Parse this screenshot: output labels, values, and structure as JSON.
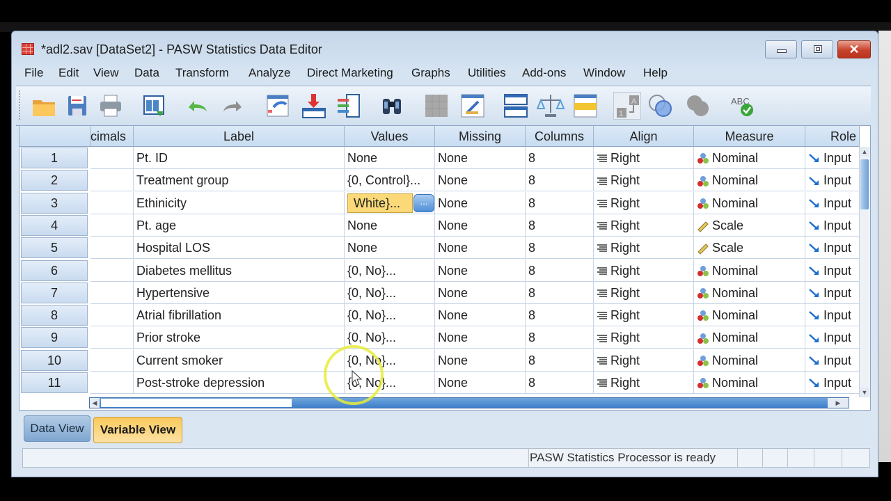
{
  "window": {
    "title": "*adl2.sav [DataSet2] - PASW Statistics Data Editor",
    "controls": {
      "minimize": "minimize",
      "maximize": "maximize",
      "close": "✕"
    }
  },
  "menu": [
    "File",
    "Edit",
    "View",
    "Data",
    "Transform",
    "Analyze",
    "Direct Marketing",
    "Graphs",
    "Utilities",
    "Add-ons",
    "Window",
    "Help"
  ],
  "toolbar": [
    "open-folder-icon",
    "save-icon",
    "print-icon",
    "recall-dialog-icon",
    "undo-icon",
    "redo-icon",
    "goto-case-icon",
    "goto-variable-icon",
    "variables-icon",
    "find-icon",
    "insert-cases-icon",
    "insert-variable-icon",
    "split-file-icon",
    "weight-cases-icon",
    "select-cases-icon",
    "value-labels-icon",
    "use-variable-sets-icon",
    "show-all-variables-icon",
    "spell-check-icon"
  ],
  "grid": {
    "columns": [
      "cimals",
      "Label",
      "Values",
      "Missing",
      "Columns",
      "Align",
      "Measure",
      "Role"
    ],
    "rows": [
      {
        "n": "1",
        "label": "Pt. ID",
        "values": "None",
        "missing": "None",
        "columns": "8",
        "align": "Right",
        "measure": "Nominal",
        "role": "Input"
      },
      {
        "n": "2",
        "label": "Treatment group",
        "values": "{0, Control}...",
        "missing": "None",
        "columns": "8",
        "align": "Right",
        "measure": "Nominal",
        "role": "Input"
      },
      {
        "n": "3",
        "label": "Ethinicity",
        "values": "White}...",
        "missing": "None",
        "columns": "8",
        "align": "Right",
        "measure": "Nominal",
        "role": "Input"
      },
      {
        "n": "4",
        "label": "Pt. age",
        "values": "None",
        "missing": "None",
        "columns": "8",
        "align": "Right",
        "measure": "Scale",
        "role": "Input"
      },
      {
        "n": "5",
        "label": "Hospital LOS",
        "values": "None",
        "missing": "None",
        "columns": "8",
        "align": "Right",
        "measure": "Scale",
        "role": "Input"
      },
      {
        "n": "6",
        "label": "Diabetes mellitus",
        "values": "{0, No}...",
        "missing": "None",
        "columns": "8",
        "align": "Right",
        "measure": "Nominal",
        "role": "Input"
      },
      {
        "n": "7",
        "label": "Hypertensive",
        "values": "{0, No}...",
        "missing": "None",
        "columns": "8",
        "align": "Right",
        "measure": "Nominal",
        "role": "Input"
      },
      {
        "n": "8",
        "label": "Atrial fibrillation",
        "values": "{0, No}...",
        "missing": "None",
        "columns": "8",
        "align": "Right",
        "measure": "Nominal",
        "role": "Input"
      },
      {
        "n": "9",
        "label": "Prior stroke",
        "values": "{0, No}...",
        "missing": "None",
        "columns": "8",
        "align": "Right",
        "measure": "Nominal",
        "role": "Input"
      },
      {
        "n": "10",
        "label": "Current smoker",
        "values": "{0, No}...",
        "missing": "None",
        "columns": "8",
        "align": "Right",
        "measure": "Nominal",
        "role": "Input"
      },
      {
        "n": "11",
        "label": "Post-stroke depression",
        "values": "{0, No}...",
        "missing": "None",
        "columns": "8",
        "align": "Right",
        "measure": "Nominal",
        "role": "Input"
      }
    ],
    "editing_row": 2,
    "ellipsis_label": "..."
  },
  "tabs": {
    "data_view": "Data View",
    "variable_view": "Variable View",
    "active": "Variable View"
  },
  "status": {
    "text": "PASW Statistics Processor is ready"
  },
  "colors": {
    "active_tab": "#f9c95c",
    "editing_cell": "#fbd978",
    "close_button": "#c8412b"
  }
}
